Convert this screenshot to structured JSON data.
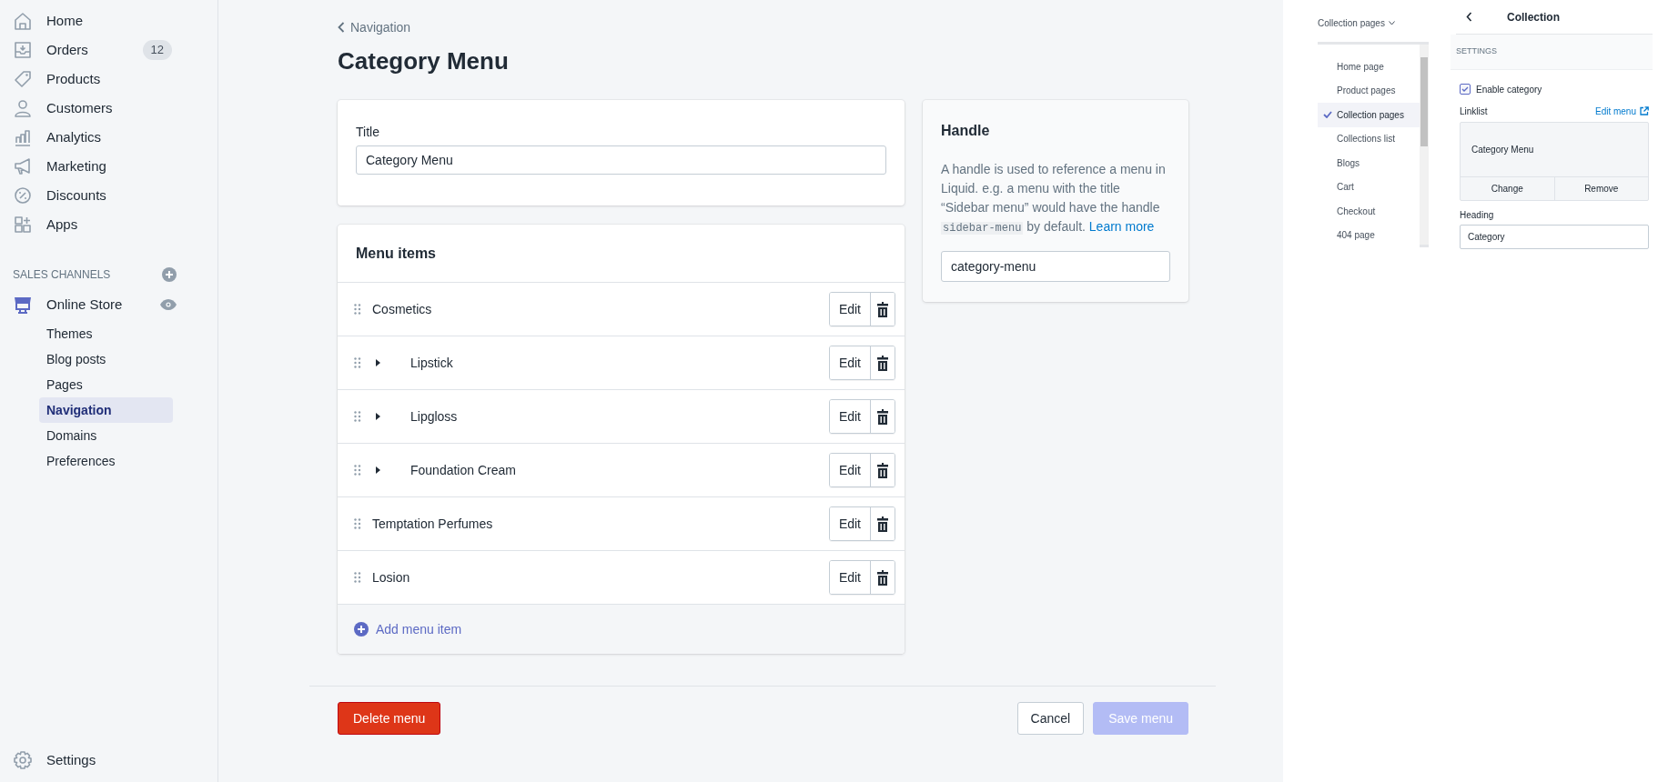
{
  "sidebar": {
    "items": [
      {
        "label": "Home",
        "selected": false
      },
      {
        "label": "Orders",
        "badge": "12",
        "selected": false
      },
      {
        "label": "Products",
        "selected": false
      },
      {
        "label": "Customers",
        "selected": false
      },
      {
        "label": "Analytics",
        "selected": false
      },
      {
        "label": "Marketing",
        "selected": false
      },
      {
        "label": "Discounts",
        "selected": false
      },
      {
        "label": "Apps",
        "selected": false
      }
    ],
    "sales_channels": {
      "heading": "SALES CHANNELS",
      "channel": {
        "label": "Online Store",
        "selected": true,
        "sub_items": [
          {
            "label": "Themes",
            "selected": false
          },
          {
            "label": "Blog posts",
            "selected": false
          },
          {
            "label": "Pages",
            "selected": false
          },
          {
            "label": "Navigation",
            "selected": true
          },
          {
            "label": "Domains",
            "selected": false
          },
          {
            "label": "Preferences",
            "selected": false
          }
        ]
      }
    },
    "settings": "Settings"
  },
  "breadcrumb": "Navigation",
  "page_title": "Category Menu",
  "title_card": {
    "label": "Title",
    "value": "Category Menu"
  },
  "menu_items": {
    "heading": "Menu items",
    "items": [
      {
        "label": "Cosmetics",
        "edit": "Edit",
        "children": [
          {
            "label": "Lipstick",
            "edit": "Edit",
            "expanded": false
          },
          {
            "label": "Lipgloss",
            "edit": "Edit",
            "expanded": false
          },
          {
            "label": "Foundation Cream",
            "edit": "Edit",
            "expanded": false
          }
        ]
      },
      {
        "label": "Temptation Perfumes",
        "edit": "Edit"
      },
      {
        "label": "Losion",
        "edit": "Edit"
      }
    ],
    "add_label": "Add menu item"
  },
  "handle_card": {
    "heading": "Handle",
    "description": [
      {
        "kind": "text",
        "text": "A handle is used to reference a menu in Liquid. e.g. a menu with the title “Sidebar menu” would have the handle "
      },
      {
        "kind": "code",
        "text": "sidebar-menu"
      },
      {
        "kind": "text",
        "text": " by default. "
      },
      {
        "kind": "link",
        "text": "Learn more"
      }
    ],
    "value": "category-menu"
  },
  "footer": {
    "delete": "Delete menu",
    "cancel": "Cancel",
    "save": {
      "label": "Save menu",
      "disabled": true
    }
  },
  "template_selector": {
    "label": "Collection pages",
    "options": [
      {
        "label": "Home page",
        "selected": false
      },
      {
        "label": "Product pages",
        "selected": false
      },
      {
        "label": "Collection pages",
        "selected": true
      },
      {
        "label": "Collections list",
        "selected": false
      },
      {
        "label": "Blogs",
        "selected": false
      },
      {
        "label": "Cart",
        "selected": false
      },
      {
        "label": "Checkout",
        "selected": false
      },
      {
        "label": "404 page",
        "selected": false
      }
    ]
  },
  "section_panel": {
    "title": "Collection",
    "section": "SETTINGS",
    "enable": {
      "label": "Enable category",
      "checked": true
    },
    "linklist": {
      "label": "Linklist",
      "edit_link": "Edit menu",
      "value": "Category Menu",
      "change": "Change",
      "remove": "Remove"
    },
    "heading": {
      "label": "Heading",
      "value": "Category"
    }
  }
}
